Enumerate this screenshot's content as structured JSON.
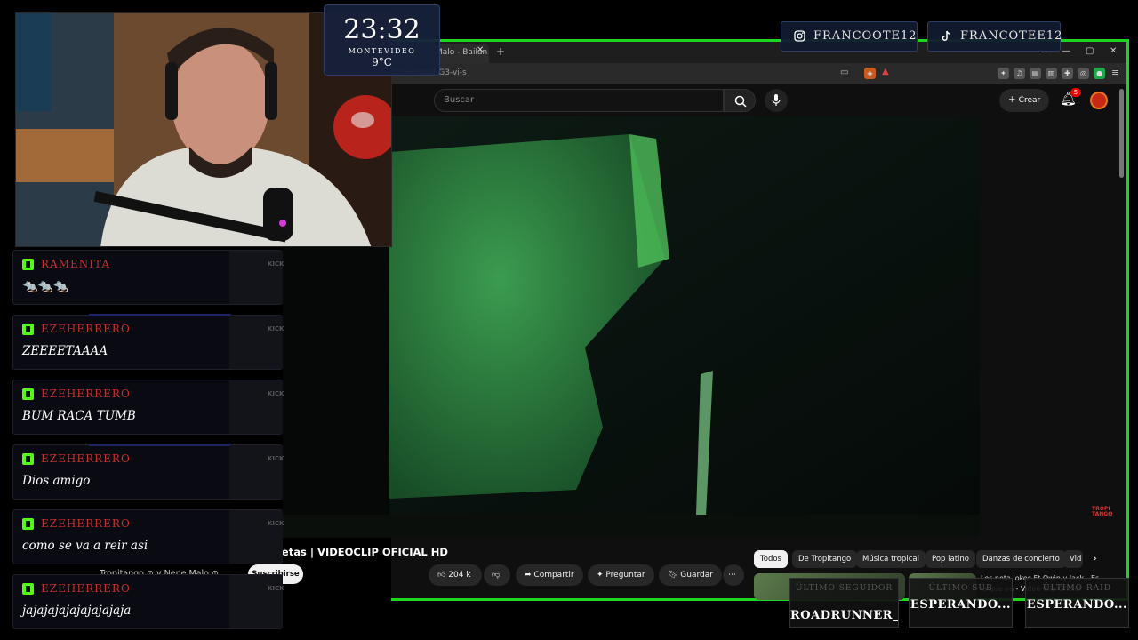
{
  "overlay": {
    "clock": {
      "time": "23:32",
      "city": "MONTEVIDEO",
      "temp": "9°C"
    },
    "socials": [
      {
        "icon": "instagram-icon",
        "handle": "FRANCOOTE12"
      },
      {
        "icon": "tiktok-icon",
        "handle": "FRANCOTEE12"
      }
    ],
    "goals": [
      {
        "label": "ÚLTIMO SEGUIDOR",
        "value": "ROADRUNNER_UY"
      },
      {
        "label": "ÚLTIMO SUB",
        "value": "ESPERANDO..."
      },
      {
        "label": "ÚLTIMO RAID",
        "value": "ESPERANDO..."
      }
    ]
  },
  "chat": {
    "messages": [
      {
        "user": "RAMENITA",
        "text": "🐀🐀🐀",
        "platform": "KICK"
      },
      {
        "user": "EZEHERRERO",
        "text": "ZEEEETAAAA",
        "platform": "KICK"
      },
      {
        "user": "EZEHERRERO",
        "text": "BUM RACA TUMB",
        "platform": "KICK"
      },
      {
        "user": "EZEHERRERO",
        "text": "Dios amigo",
        "platform": "KICK"
      },
      {
        "user": "EZEHERRERO",
        "text": "como se va a reir asi",
        "platform": "KICK"
      },
      {
        "user": "EZEHERRERO",
        "text": "jajajajajajajajajaja",
        "platform": "KICK"
      }
    ]
  },
  "browser": {
    "tab_title": "Malo - Bailan Rochas",
    "new_tab": "+",
    "url": "ch?v=OnKRG3-vi-s",
    "window_controls": {
      "minimize": "—",
      "maximize": "▢",
      "close": "✕"
    }
  },
  "youtube": {
    "search_placeholder": "Buscar",
    "create_label": "Crear",
    "notification_count": "5",
    "video": {
      "title": "Nene Malo - Bailan Rochas Y Chetas | VIDEOCLIP OFICIAL HD",
      "channel": "Tropitango ⊙ y Nene Malo ⊙",
      "subscribe_label": "Suscribirse",
      "likes": "204 k",
      "share_label": "Compartir",
      "ask_label": "Preguntar",
      "save_label": "Guardar",
      "watermark": "TROPI TANGO"
    },
    "chips": [
      "Todos",
      "De Tropitango",
      "Música tropical",
      "Pop latino",
      "Danzas de concierto",
      "Vid"
    ],
    "related_title": "Los nota lokos Ft Owin y Jack - Es la que va - Video Clip Oficial"
  }
}
